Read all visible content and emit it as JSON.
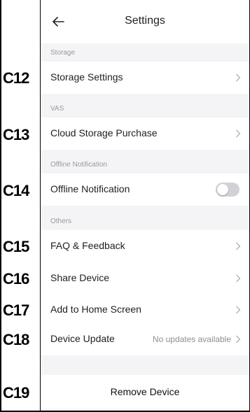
{
  "header": {
    "title": "Settings"
  },
  "sections": {
    "storage": "Storage",
    "vas": "VAS",
    "offline": "Offline Notification",
    "others": "Others"
  },
  "rows": {
    "storage_settings": "Storage Settings",
    "cloud_storage": "Cloud Storage Purchase",
    "offline_notification": "Offline Notification",
    "offline_notification_enabled": false,
    "faq": "FAQ & Feedback",
    "share_device": "Share Device",
    "add_home": "Add to Home Screen",
    "device_update": "Device Update",
    "device_update_value": "No updates available"
  },
  "remove_button": "Remove Device",
  "callouts": [
    "C12",
    "C13",
    "C14",
    "C15",
    "C16",
    "C17",
    "C18",
    "C19"
  ],
  "colors": {
    "toggle_off": "#d1d1d6",
    "section_bg": "#f4f4f6"
  }
}
